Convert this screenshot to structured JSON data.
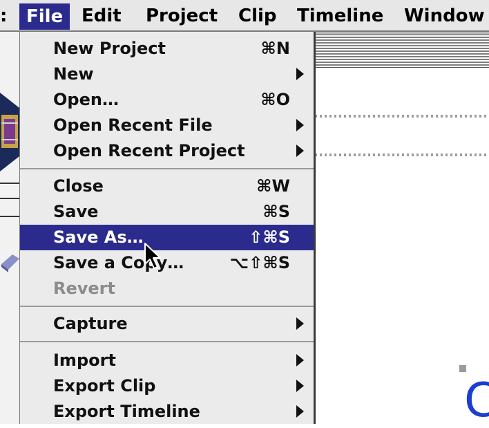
{
  "menubar": {
    "edge_glyph": ":",
    "items": [
      "File",
      "Edit",
      "Project",
      "Clip",
      "Timeline",
      "Window"
    ],
    "active": "File"
  },
  "file_menu": {
    "group1": [
      {
        "label": "New Project",
        "shortcut": "⌘N"
      },
      {
        "label": "New",
        "submenu": true
      },
      {
        "label": "Open…",
        "shortcut": "⌘O"
      },
      {
        "label": "Open Recent File",
        "submenu": true
      },
      {
        "label": "Open Recent Project",
        "submenu": true
      }
    ],
    "group2": [
      {
        "label": "Close",
        "shortcut": "⌘W"
      },
      {
        "label": "Save",
        "shortcut": "⌘S"
      },
      {
        "label": "Save As…",
        "shortcut": "⇧⌘S",
        "highlighted": true
      },
      {
        "label": "Save a Copy…",
        "shortcut": "⌥⇧⌘S"
      },
      {
        "label": "Revert",
        "disabled": true
      }
    ],
    "group3": [
      {
        "label": "Capture",
        "submenu": true
      }
    ],
    "group4": [
      {
        "label": "Import",
        "submenu": true
      },
      {
        "label": "Export Clip",
        "submenu": true
      },
      {
        "label": "Export Timeline",
        "submenu": true
      }
    ]
  },
  "background": {
    "partial_letter": "C"
  },
  "colors": {
    "highlight": "#2b2b8e",
    "menu_background": "#ebebeb",
    "disabled_text": "#8c8c8c",
    "accent_letter": "#1a3fd0"
  },
  "icons": {
    "cursor": "arrow-pointer-icon",
    "submenu": "submenu-arrow-icon"
  }
}
